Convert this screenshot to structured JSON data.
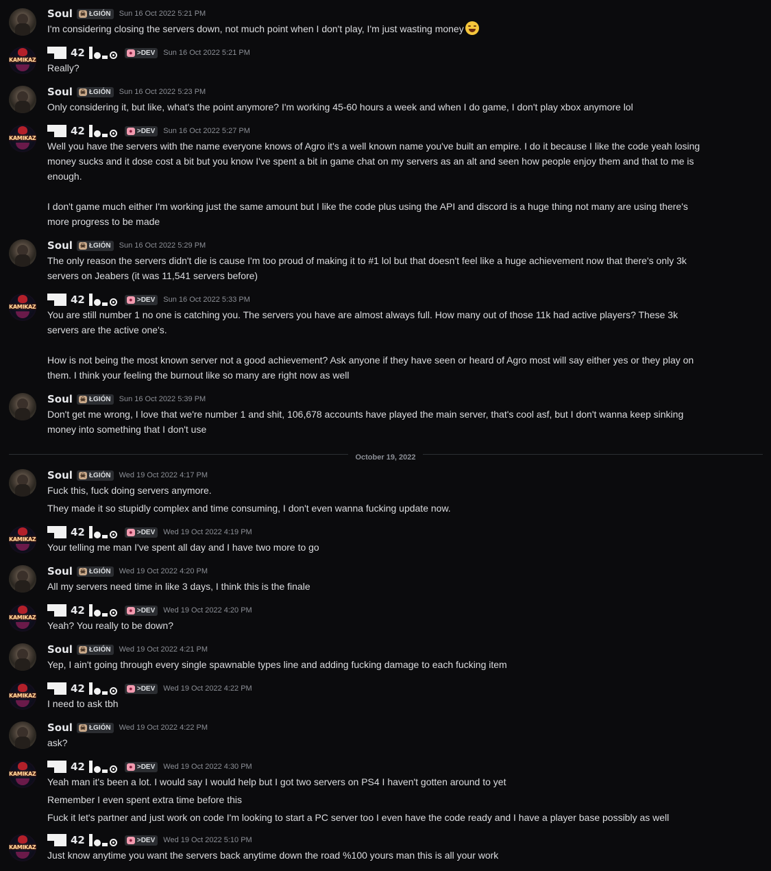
{
  "users": {
    "soul": {
      "name": "Soul",
      "tag": "ŁGIÓN",
      "tag_icon": "skull-icon"
    },
    "dev": {
      "name_number": "42",
      "tag": ">DEV",
      "tag_icon": "pig-icon",
      "avatar_text": "KAMIKAZE"
    }
  },
  "divider": {
    "label": "October 19, 2022"
  },
  "messages": [
    {
      "user": "soul",
      "timestamp": "Sun 16 Oct 2022 5:21 PM",
      "lines": [
        "I'm considering closing the servers down, not much point when I don't play, I'm just wasting money"
      ],
      "emoji": "joy-emoji"
    },
    {
      "user": "dev",
      "timestamp": "Sun 16 Oct 2022 5:21 PM",
      "lines": [
        "Really?"
      ]
    },
    {
      "user": "soul",
      "timestamp": "Sun 16 Oct 2022 5:23 PM",
      "lines": [
        "Only considering it, but like, what's the point anymore? I'm working 45-60 hours a week and when I do game, I don't play xbox anymore lol"
      ]
    },
    {
      "user": "dev",
      "timestamp": "Sun 16 Oct 2022 5:27 PM",
      "lines": [
        "Well you have the servers with the name everyone knows of Agro it's a well known name you've built an empire. I do it because I like the code yeah losing",
        "money sucks and it dose cost a bit but you know I've spent a bit in game chat on my servers as an alt and seen how people enjoy them and that to me is",
        "enough.",
        "I don't game much either I'm working just the same amount but I like the code plus using the API and discord is a huge thing not many are using there's",
        "more progress to be made"
      ]
    },
    {
      "user": "soul",
      "timestamp": "Sun 16 Oct 2022 5:29 PM",
      "lines": [
        "The only reason the servers didn't die is cause I'm too proud of making it to #1 lol but that doesn't feel like a huge achievement now that there's only 3k",
        "servers on Jeabers (it was 11,541 servers before)"
      ]
    },
    {
      "user": "dev",
      "timestamp": "Sun 16 Oct 2022 5:33 PM",
      "lines": [
        "You are still number 1 no one is catching you. The servers you have are almost always full. How many out of those 11k had active players? These 3k",
        "servers are the active one's.",
        "How is not being the most known server not a good achievement? Ask anyone if they have seen or heard of Agro most will say either yes or they play on",
        "them. I think your feeling the burnout like so many are right now as well"
      ]
    },
    {
      "user": "soul",
      "timestamp": "Sun 16 Oct 2022 5:39 PM",
      "lines": [
        "Don't get me wrong, I love that we're number 1 and shit, 106,678 accounts have played the main server, that's cool asf, but I don't wanna keep sinking",
        "money into something that I don't use"
      ]
    },
    {
      "user": "soul",
      "timestamp": "Wed 19 Oct 2022 4:17 PM",
      "lines": [
        "Fuck this, fuck doing servers anymore.",
        "They made it so stupidly complex and time consuming, I don't even wanna fucking update now."
      ]
    },
    {
      "user": "dev",
      "timestamp": "Wed 19 Oct 2022 4:19 PM",
      "lines": [
        "Your telling me man I've spent all day and I have two more to go"
      ]
    },
    {
      "user": "soul",
      "timestamp": "Wed 19 Oct 2022 4:20 PM",
      "lines": [
        "All my servers need time in like 3 days, I think this is the finale"
      ]
    },
    {
      "user": "dev",
      "timestamp": "Wed 19 Oct 2022 4:20 PM",
      "lines": [
        "Yeah? You really to be down?"
      ]
    },
    {
      "user": "soul",
      "timestamp": "Wed 19 Oct 2022 4:21 PM",
      "lines": [
        "Yep, I ain't going through every single spawnable types line and adding fucking damage to each fucking item"
      ]
    },
    {
      "user": "dev",
      "timestamp": "Wed 19 Oct 2022 4:22 PM",
      "lines": [
        "I need to ask tbh"
      ]
    },
    {
      "user": "soul",
      "timestamp": "Wed 19 Oct 2022 4:22 PM",
      "lines": [
        "ask?"
      ]
    },
    {
      "user": "dev",
      "timestamp": "Wed 19 Oct 2022 4:30 PM",
      "lines": [
        "Yeah man it's been a lot. I would say I would help but I got two servers on PS4 I haven't gotten around to yet",
        "Remember I even spent extra time before this",
        "Fuck it let's partner and just work on code I'm looking to start a PC server too I even have the code ready and I have a player base possibly as well"
      ]
    },
    {
      "user": "dev",
      "timestamp": "Wed 19 Oct 2022 5:10 PM",
      "lines": [
        "Just know anytime you want the servers back anytime down the road %100 yours man this is all your work"
      ]
    }
  ]
}
